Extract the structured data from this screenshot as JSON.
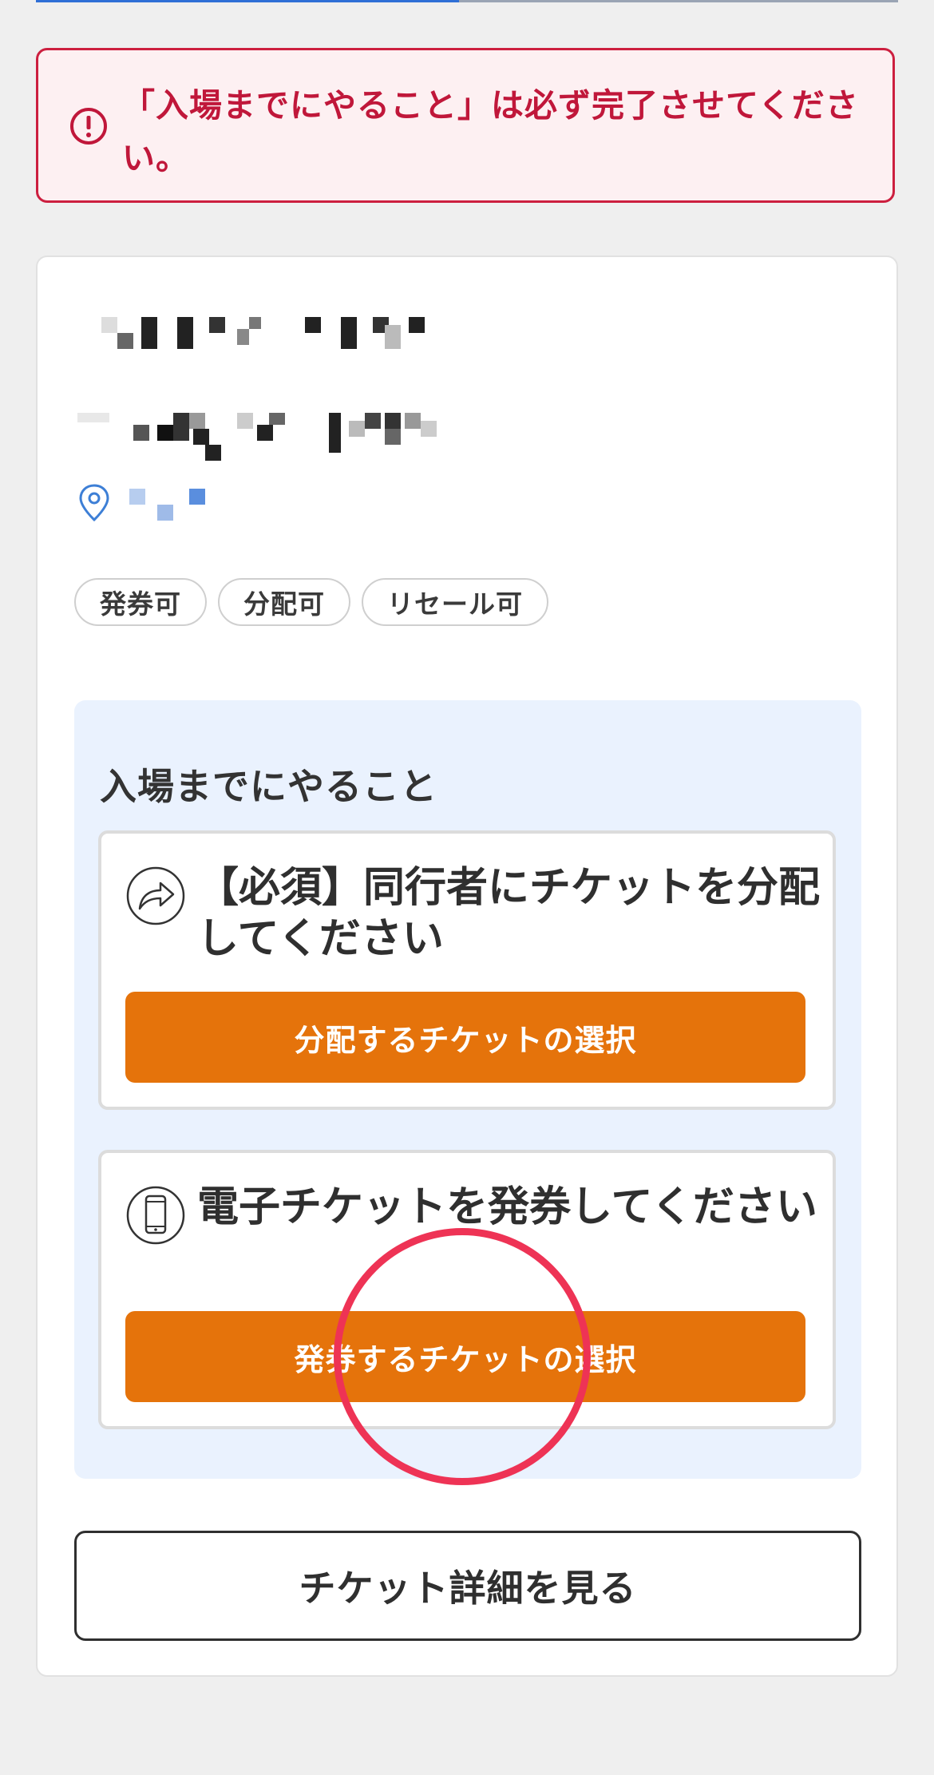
{
  "alert": {
    "icon": "exclamation-circle-icon",
    "message": "「入場までにやること」は必ず完了させてください。",
    "color": "#c0173a"
  },
  "event": {
    "location_icon": "map-pin-icon"
  },
  "tags": [
    "発券可",
    "分配可",
    "リセール可"
  ],
  "todo": {
    "title": "入場までにやること",
    "tasks": [
      {
        "icon": "share-arrow-icon",
        "text": "【必須】同行者にチケットを分配してください",
        "button_label": "分配するチケットの選択"
      },
      {
        "icon": "smartphone-icon",
        "text": "電子チケットを発券してください",
        "button_label": "発券するチケットの選択"
      }
    ]
  },
  "detail_button_label": "チケット詳細を見る",
  "colors": {
    "accent_orange": "#e5730b",
    "alert_red": "#cc1f3f",
    "annotation_circle": "#ee3355",
    "panel_blue": "#eaf2fe"
  }
}
